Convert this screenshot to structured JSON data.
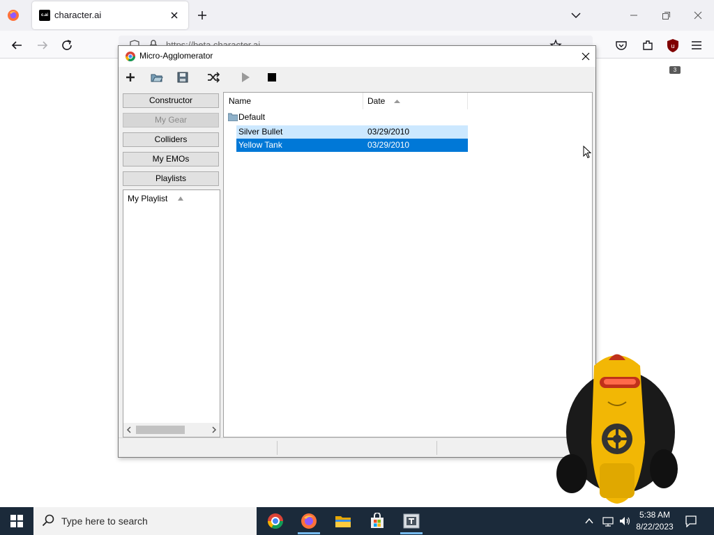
{
  "browser": {
    "tab_title": "character.ai",
    "tab_favicon": "c.ai",
    "url": "https://beta.character.ai",
    "extension_badge": "3",
    "icons": [
      "firefox-icon",
      "close-icon",
      "plus-icon",
      "chevron-down-icon",
      "minimize-icon",
      "restore-icon",
      "back-icon",
      "forward-icon",
      "reload-icon",
      "shield-icon",
      "lock-icon",
      "star-icon",
      "pocket-icon",
      "extensions-icon",
      "ublock-icon",
      "hamburger-menu-icon"
    ]
  },
  "app": {
    "title": "Micro-Agglomerator",
    "toolbar": {
      "add": "add-icon",
      "open": "open-folder-icon",
      "save": "save-icon",
      "shuffle": "shuffle-icon",
      "play": "play-icon",
      "stop": "stop-icon"
    },
    "nav_buttons": {
      "constructor": "Constructor",
      "my_gear": "My Gear",
      "colliders": "Colliders",
      "my_emos": "My EMOs",
      "playlists": "Playlists"
    },
    "playlist_header": "My Playlist",
    "columns": {
      "name": "Name",
      "date": "Date"
    },
    "folder": "Default",
    "rows": [
      {
        "name": "Silver Bullet",
        "date": "03/29/2010",
        "state": "hover"
      },
      {
        "name": "Yellow Tank",
        "date": "03/29/2010",
        "state": "selected"
      }
    ]
  },
  "taskbar": {
    "search_placeholder": "Type here to search",
    "apps": [
      "chrome-icon",
      "firefox-icon",
      "file-explorer-icon",
      "store-icon",
      "agglomerator-icon"
    ],
    "time": "5:38 AM",
    "date": "8/22/2023"
  },
  "colors": {
    "selection": "#0078d7",
    "hover": "#cce8ff",
    "taskbar": "#1b2a3a"
  }
}
